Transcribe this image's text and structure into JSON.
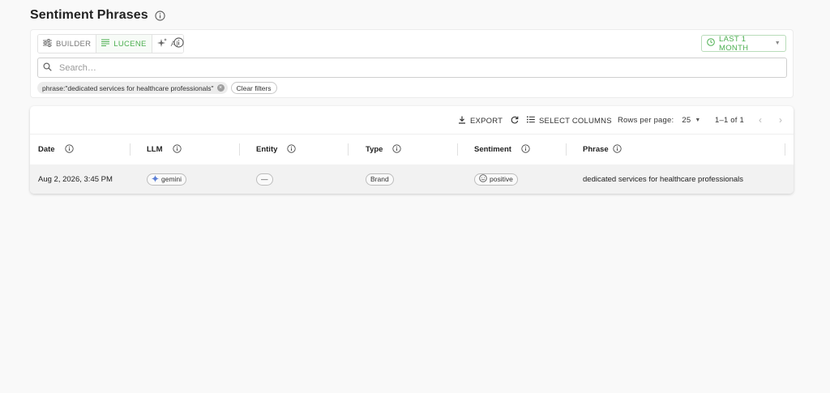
{
  "page": {
    "title": "Sentiment Phrases"
  },
  "query_modes": [
    {
      "label": "BUILDER",
      "icon": "sliders-icon",
      "active": false
    },
    {
      "label": "LUCENE",
      "icon": "lines-icon",
      "active": true
    },
    {
      "label": "AI",
      "icon": "sparkles-icon",
      "active": false
    }
  ],
  "time_range": {
    "label": "LAST 1 MONTH"
  },
  "search": {
    "placeholder": "Search…",
    "value": ""
  },
  "active_filters": [
    {
      "label": "phrase:\"dedicated services for healthcare professionals\""
    }
  ],
  "clear_filters_label": "Clear filters",
  "toolbar": {
    "export_label": "EXPORT",
    "select_columns_label": "SELECT COLUMNS",
    "rows_per_page_label": "Rows per page:",
    "rows_per_page_value": "25",
    "pagination_text": "1–1 of 1"
  },
  "columns": [
    {
      "label": "Date"
    },
    {
      "label": "LLM"
    },
    {
      "label": "Entity"
    },
    {
      "label": "Type"
    },
    {
      "label": "Sentiment"
    },
    {
      "label": "Phrase"
    }
  ],
  "rows": [
    {
      "date": "Aug 2, 2026, 3:45 PM",
      "llm": "gemini",
      "entity": "—",
      "type": "Brand",
      "sentiment": "positive",
      "phrase": "dedicated services for healthcare professionals"
    }
  ],
  "colors": {
    "accent": "#4caf50",
    "text": "#1f1f1f",
    "muted": "#777777"
  }
}
